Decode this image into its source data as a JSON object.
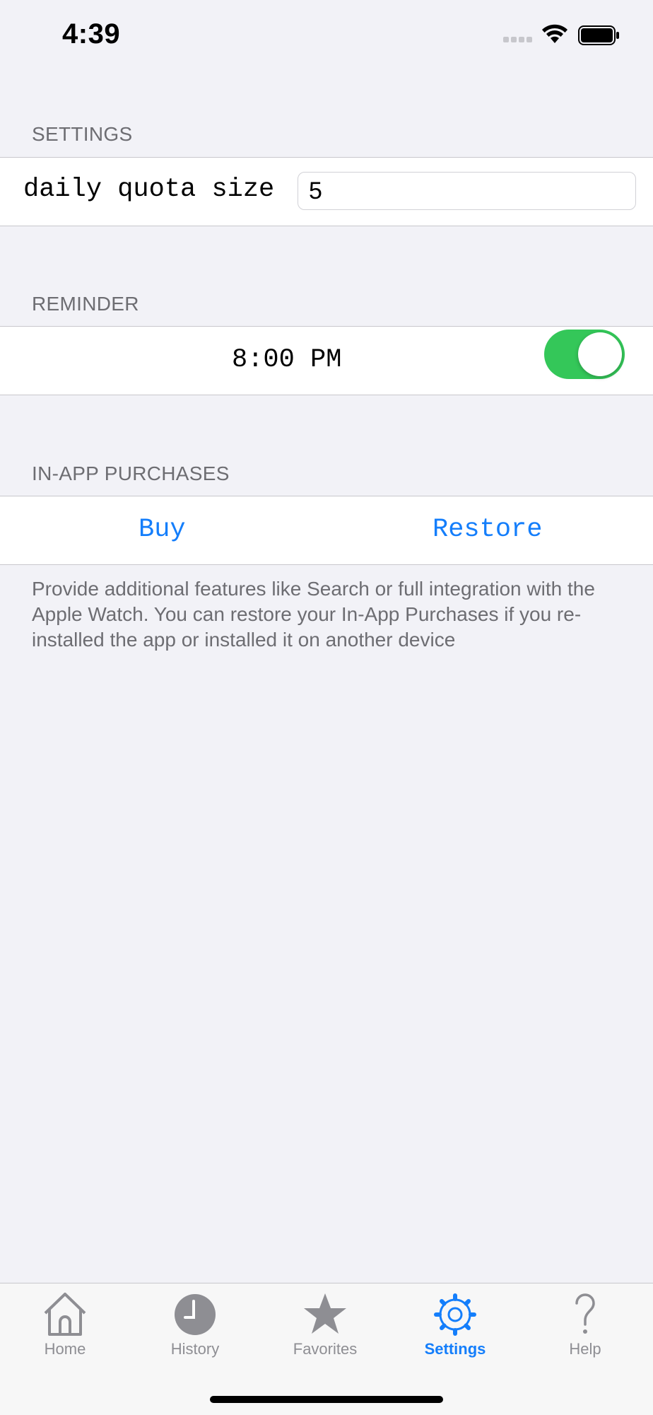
{
  "status_bar": {
    "time": "4:39"
  },
  "settings_section": {
    "header": "SETTINGS",
    "quota_label": "daily quota size",
    "quota_value": "5"
  },
  "reminder_section": {
    "header": "REMINDER",
    "time": "8:00 PM",
    "enabled": true
  },
  "iap_section": {
    "header": "IN-APP PURCHASES",
    "buy_label": "Buy",
    "restore_label": "Restore",
    "footer": "Provide additional features like Search or full integration with the Apple Watch. You can restore your In-App Purchases if you re-installed the app or installed it on another device"
  },
  "tab_bar": {
    "tabs": [
      {
        "label": "Home",
        "icon": "house-icon",
        "active": false
      },
      {
        "label": "History",
        "icon": "clock-icon",
        "active": false
      },
      {
        "label": "Favorites",
        "icon": "star-icon",
        "active": false
      },
      {
        "label": "Settings",
        "icon": "gear-icon",
        "active": true
      },
      {
        "label": "Help",
        "icon": "question-mark-icon",
        "active": false
      }
    ]
  },
  "colors": {
    "accent": "#147efb",
    "toggle_on": "#34c759",
    "background": "#f2f2f7",
    "inactive_tab": "#8e8e93"
  }
}
